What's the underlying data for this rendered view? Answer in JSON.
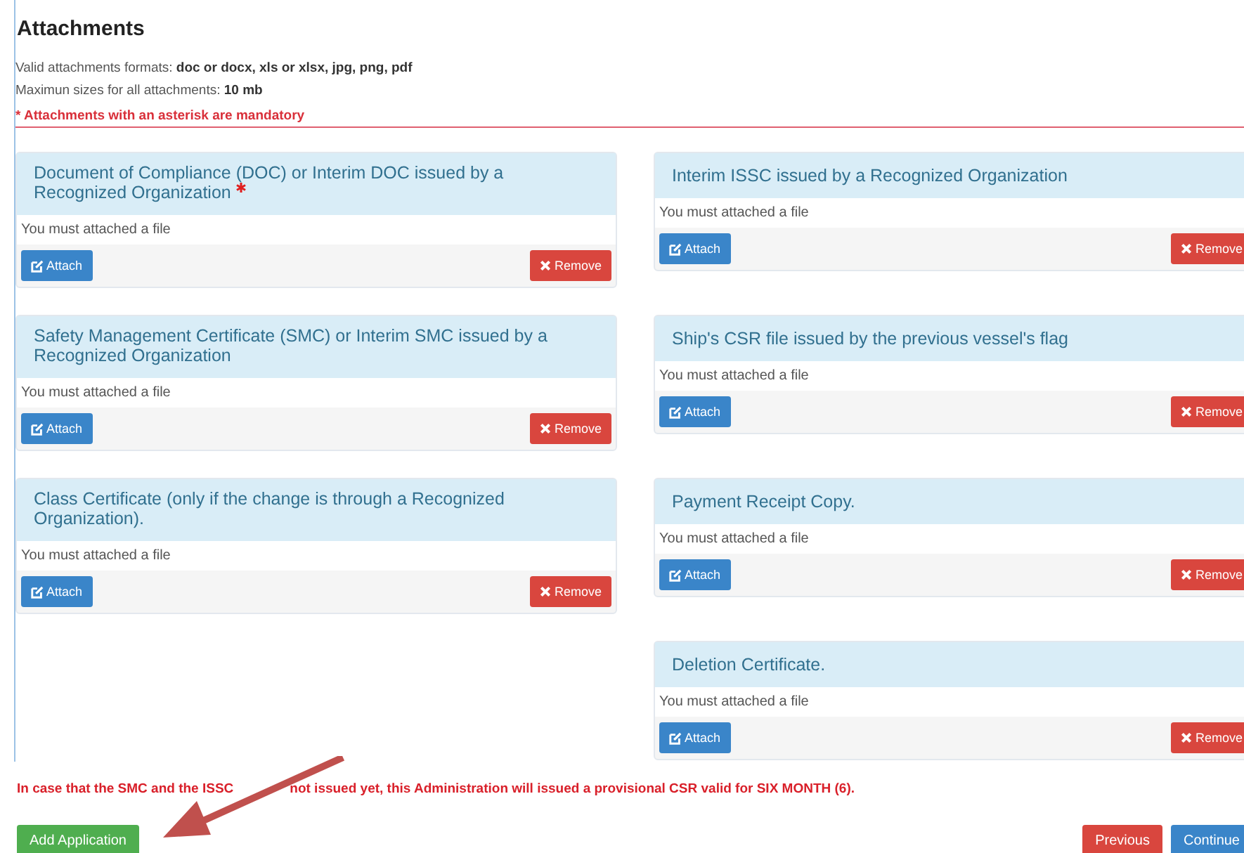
{
  "title": "Attachments",
  "info": [
    {
      "label": "Valid attachments formats:",
      "value": "doc or docx, xls or xlsx, jpg, png, pdf"
    },
    {
      "label": "Maximun sizes for all attachments:",
      "value": "10 mb"
    }
  ],
  "mandatory_note": "* Attachments with an asterisk are mandatory",
  "left_panels": [
    {
      "title": "Document of Compliance (DOC) or Interim DOC issued by a Recognized Organization",
      "required": true,
      "message": "You must attached a file",
      "attach": "Attach",
      "remove": "Remove"
    },
    {
      "title": "Safety Management Certificate (SMC) or Interim SMC issued by a Recognized Organization",
      "required": false,
      "message": "You must attached a file",
      "attach": "Attach",
      "remove": "Remove"
    },
    {
      "title": "Class Certificate (only if the change is through a Recognized Organization).",
      "required": false,
      "message": "You must attached a file",
      "attach": "Attach",
      "remove": "Remove"
    }
  ],
  "right_panels": [
    {
      "title": "Interim ISSC issued by a Recognized Organization",
      "required": false,
      "message": "You must attached a file",
      "attach": "Attach",
      "remove": "Remove"
    },
    {
      "title": "Ship's CSR file issued by the previous vessel's flag",
      "required": false,
      "message": "You must attached a file",
      "attach": "Attach",
      "remove": "Remove"
    },
    {
      "title": "Payment Receipt Copy.",
      "required": false,
      "message": "You must attached a file",
      "attach": "Attach",
      "remove": "Remove"
    },
    {
      "title": "Deletion Certificate.",
      "required": false,
      "message": "You must attached a file",
      "attach": "Attach",
      "remove": "Remove"
    }
  ],
  "provisional_note": [
    "In case that the SMC and the ISSC",
    "not issued yet, this Administration will issued a provisional CSR valid for SIX MONTH (6)."
  ],
  "buttons": {
    "add": "Add Application",
    "previous": "Previous",
    "continue": "Continue"
  }
}
